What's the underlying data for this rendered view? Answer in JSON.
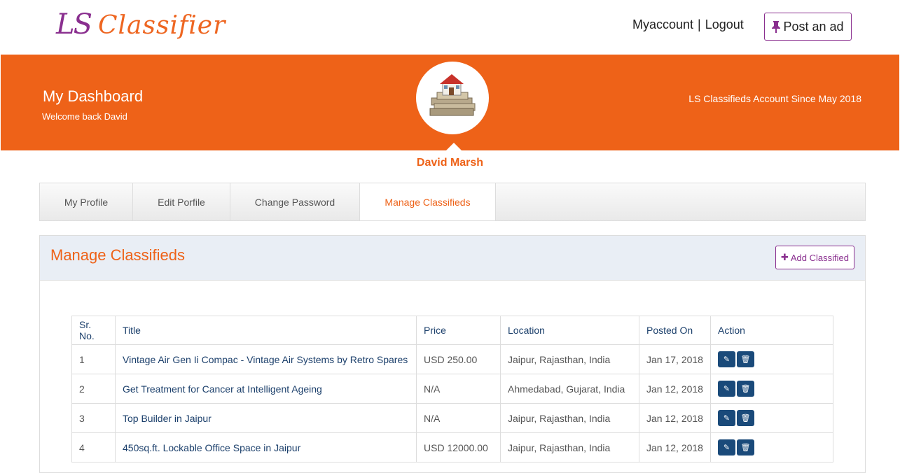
{
  "header": {
    "logo_ls": "LS",
    "logo_text": "Classifier",
    "myaccount": "Myaccount",
    "separator": "|",
    "logout": "Logout",
    "post_ad": "Post an ad"
  },
  "banner": {
    "title": "My Dashboard",
    "welcome": "Welcome back David",
    "since": "LS Classifieds Account Since May 2018",
    "user_name": "David Marsh"
  },
  "tabs": [
    {
      "label": "My Profile"
    },
    {
      "label": "Edit Porfile"
    },
    {
      "label": "Change Password"
    },
    {
      "label": "Manage Classifieds"
    }
  ],
  "panel": {
    "title": "Manage Classifieds",
    "add_label": "Add Classified"
  },
  "table": {
    "headers": [
      "Sr. No.",
      "Title",
      "Price",
      "Location",
      "Posted On",
      "Action"
    ],
    "rows": [
      {
        "sr": "1",
        "title": "Vintage Air Gen Ii Compac - Vintage Air Systems by Retro Spares",
        "price": "USD 250.00",
        "location": "Jaipur, Rajasthan, India",
        "posted": "Jan 17, 2018"
      },
      {
        "sr": "2",
        "title": "Get Treatment for Cancer at Intelligent Ageing",
        "price": "N/A",
        "location": "Ahmedabad, Gujarat, India",
        "posted": "Jan 12, 2018"
      },
      {
        "sr": "3",
        "title": "Top Builder in Jaipur",
        "price": "N/A",
        "location": "Jaipur, Rajasthan, India",
        "posted": "Jan 12, 2018"
      },
      {
        "sr": "4",
        "title": "450sq.ft. Lockable Office Space in Jaipur",
        "price": "USD 12000.00",
        "location": "Jaipur, Rajasthan, India",
        "posted": "Jan 12, 2018"
      }
    ]
  },
  "icons": {
    "pin": "pin-icon",
    "plus": "plus-icon",
    "edit": "pencil-icon",
    "delete": "trash-icon",
    "avatar": "house-money-icon"
  },
  "colors": {
    "brand_orange": "#ee6218",
    "brand_purple": "#8a2f8f",
    "action_blue": "#1a4a7a",
    "link_blue": "#1b3f6b"
  }
}
